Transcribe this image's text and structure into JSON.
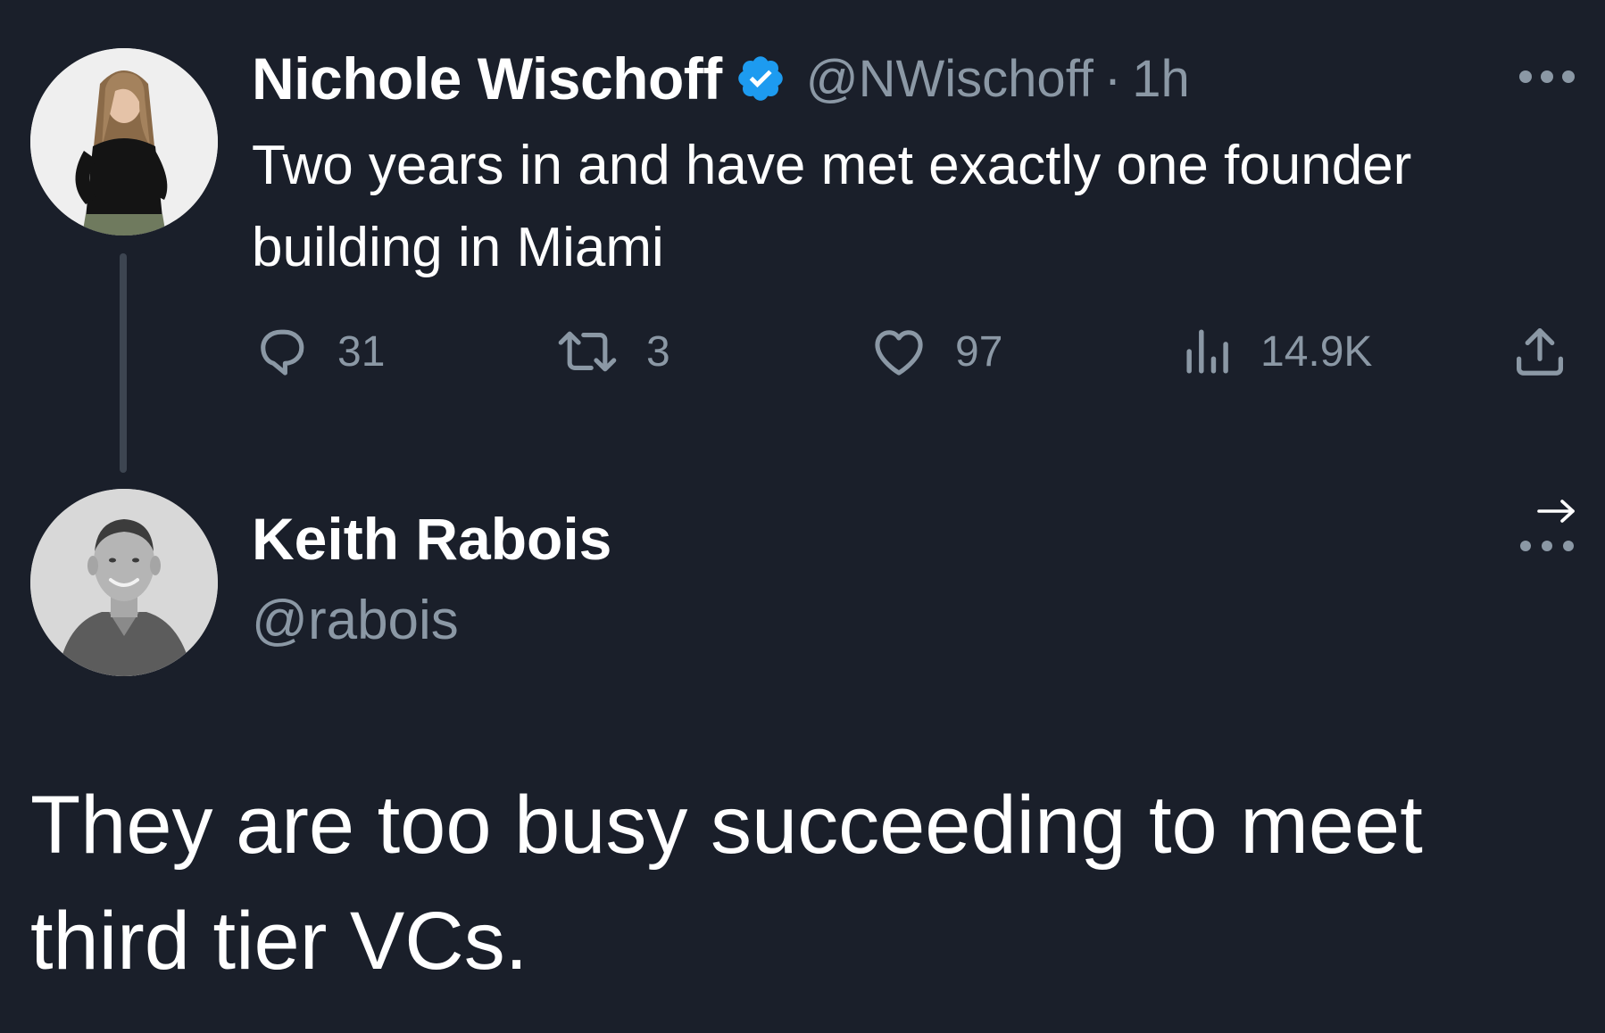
{
  "original_tweet": {
    "author_name": "Nichole Wischoff",
    "handle": "@NWischoff",
    "separator": "·",
    "time": "1h",
    "verified": true,
    "text": "Two years in and have met exactly one founder building in Miami",
    "actions": {
      "replies": "31",
      "retweets": "3",
      "likes": "97",
      "views": "14.9K"
    }
  },
  "reply_tweet": {
    "author_name": "Keith Rabois",
    "handle": "@rabois",
    "text": "They are too busy succeeding to meet third tier VCs."
  },
  "icons": {
    "verified": "verified-badge-icon",
    "more": "more-options-icon",
    "reply": "reply-icon",
    "retweet": "retweet-icon",
    "like": "heart-icon",
    "views": "views-chart-icon",
    "share": "share-icon",
    "arrow": "arrow-right-icon"
  },
  "colors": {
    "background": "#1a1f2a",
    "primary_text": "#ffffff",
    "secondary_text": "#8b98a5",
    "verified_blue": "#1d9bf0",
    "thread_line": "#3d4551"
  }
}
